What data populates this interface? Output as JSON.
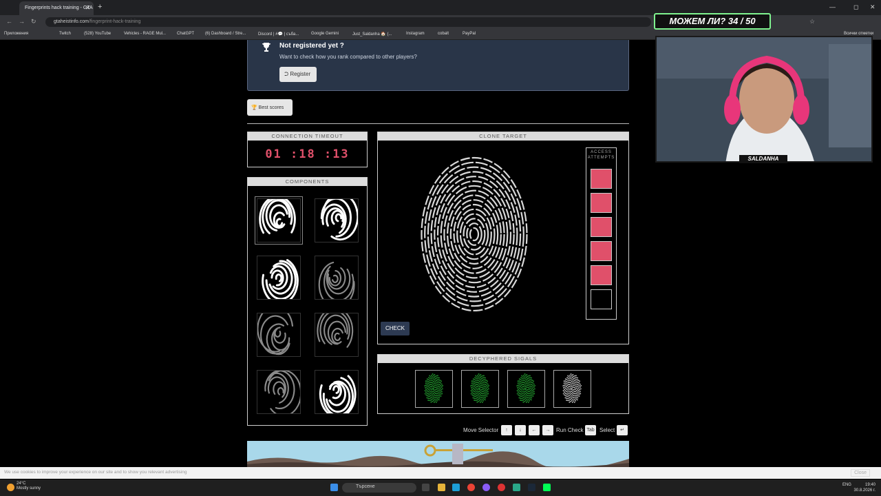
{
  "browser": {
    "tab_title": "Fingerprints hack training - GTA",
    "url_host": "gtaheistinfo.com",
    "url_path": "/fingerprint-hack-training",
    "bookmarks": [
      "Приложения",
      "Twitch",
      "(528) YouTube",
      "Vehicles - RAGE Mul...",
      "ChatGPT",
      "(6) Dashboard / Stre...",
      "Discord | #💬 | съба...",
      "Google Gemini",
      "Just_Saldanha 🏠 (...",
      "Instagram",
      "cobalt",
      "PayPal"
    ],
    "bookmarks_right": "Всички отметки"
  },
  "register": {
    "title": "Not registered yet ?",
    "subtitle": "Want to check how you rank compared to other players?",
    "button": "Register"
  },
  "best_scores_label": "Best scores",
  "timeout": {
    "title": "CONNECTION TIMEOUT",
    "value": "01 :18 :13"
  },
  "components": {
    "title": "COMPONENTS",
    "count": 8,
    "selected_index": 0
  },
  "clone": {
    "title": "CLONE TARGET",
    "attempts_label": "ACCESS ATTEMPTS",
    "attempts_total": 6,
    "attempts_filled": 5,
    "check_label": "CHECK"
  },
  "signals": {
    "title": "DECYPHERED SIGALS",
    "states": [
      "green",
      "green",
      "green",
      "white"
    ]
  },
  "controls": {
    "move_selector": "Move Selector",
    "keys": [
      "↑",
      "↓",
      "←",
      "→"
    ],
    "run_check": "Run Check",
    "run_key": "Tab",
    "select": "Select",
    "select_key": "↵"
  },
  "cookie": {
    "text": "We use cookies to improve your experience on our site and to show you relevant advertising",
    "close": "Close"
  },
  "taskbar": {
    "temp": "24°C",
    "weather": "Mostly sunny",
    "search_placeholder": "Търсене",
    "lang": "ENG",
    "time": "19:40",
    "date": "30.8.2026 г."
  },
  "stream": {
    "banner": "МОЖЕМ ЛИ? 34 / 50",
    "name": "SALDANHA"
  },
  "colors": {
    "accent_red": "#e0506a",
    "panel_navy": "#293548",
    "signal_green": "#1f8f2a"
  }
}
